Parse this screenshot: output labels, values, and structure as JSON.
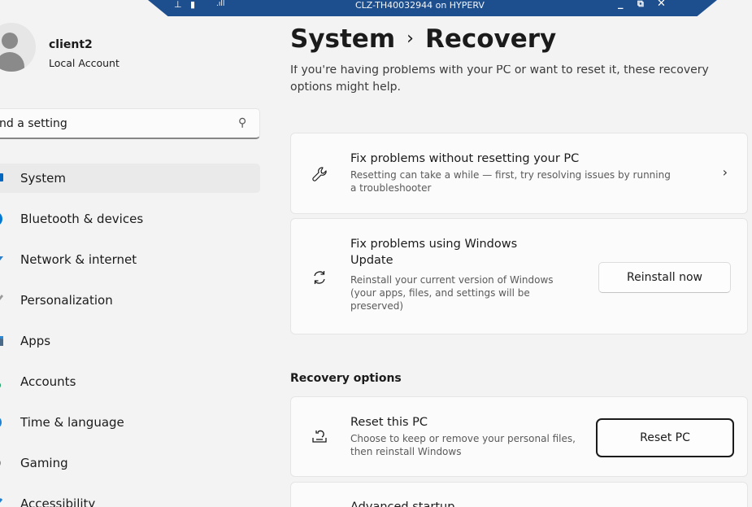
{
  "window": {
    "connection_title": "CLZ-TH40032944 on HYPERV",
    "bar_icons": [
      "pin-icon",
      "lock-icon",
      "signal-icon"
    ],
    "controls": [
      "minimize-icon",
      "restore-icon",
      "close-icon"
    ]
  },
  "profile": {
    "name": "client2",
    "account_type": "Local Account"
  },
  "search": {
    "value": "nd a setting",
    "icon": "search-icon"
  },
  "nav": {
    "items": [
      {
        "label": "System",
        "icon": "system-icon",
        "color": "#0067c0",
        "active": true
      },
      {
        "label": "Bluetooth & devices",
        "icon": "bluetooth-icon",
        "color": "#0078d4"
      },
      {
        "label": "Network & internet",
        "icon": "network-icon",
        "color": "#2d7dc8"
      },
      {
        "label": "Personalization",
        "icon": "brush-icon",
        "color": "#9a9a9a"
      },
      {
        "label": "Apps",
        "icon": "apps-icon",
        "color": "#4a6a8a"
      },
      {
        "label": "Accounts",
        "icon": "accounts-icon",
        "color": "#2aa36b"
      },
      {
        "label": "Time & language",
        "icon": "globe-icon",
        "color": "#1f7fd1"
      },
      {
        "label": "Gaming",
        "icon": "gaming-icon",
        "color": "#8a8a8a"
      },
      {
        "label": "Accessibility",
        "icon": "accessibility-icon",
        "color": "#1f7fd1"
      }
    ]
  },
  "header": {
    "breadcrumb_parent": "System",
    "separator": "›",
    "breadcrumb_current": "Recovery",
    "intro": "If you're having problems with your PC or want to reset it, these recovery options might help."
  },
  "cards": {
    "troubleshoot": {
      "title": "Fix problems without resetting your PC",
      "description": "Resetting can take a while — first, try resolving issues by running a troubleshooter",
      "icon": "wrench-icon",
      "chevron": "›"
    },
    "windows_update": {
      "title": "Fix problems using Windows Update",
      "description": "Reinstall your current version of Windows (your apps, files, and settings will be preserved)",
      "icon": "refresh-icon",
      "button": "Reinstall now"
    }
  },
  "recovery_options": {
    "heading": "Recovery options",
    "reset": {
      "title": "Reset this PC",
      "description": "Choose to keep or remove your personal files, then reinstall Windows",
      "icon": "reset-pc-icon",
      "button": "Reset PC"
    },
    "advanced": {
      "title": "Advanced startup",
      "icon": "advanced-startup-icon"
    }
  },
  "colors": {
    "accent": "#0067c0",
    "background": "#f3f3f3",
    "card": "#fbfbfb",
    "connection_bar": "#1d4f8f"
  }
}
